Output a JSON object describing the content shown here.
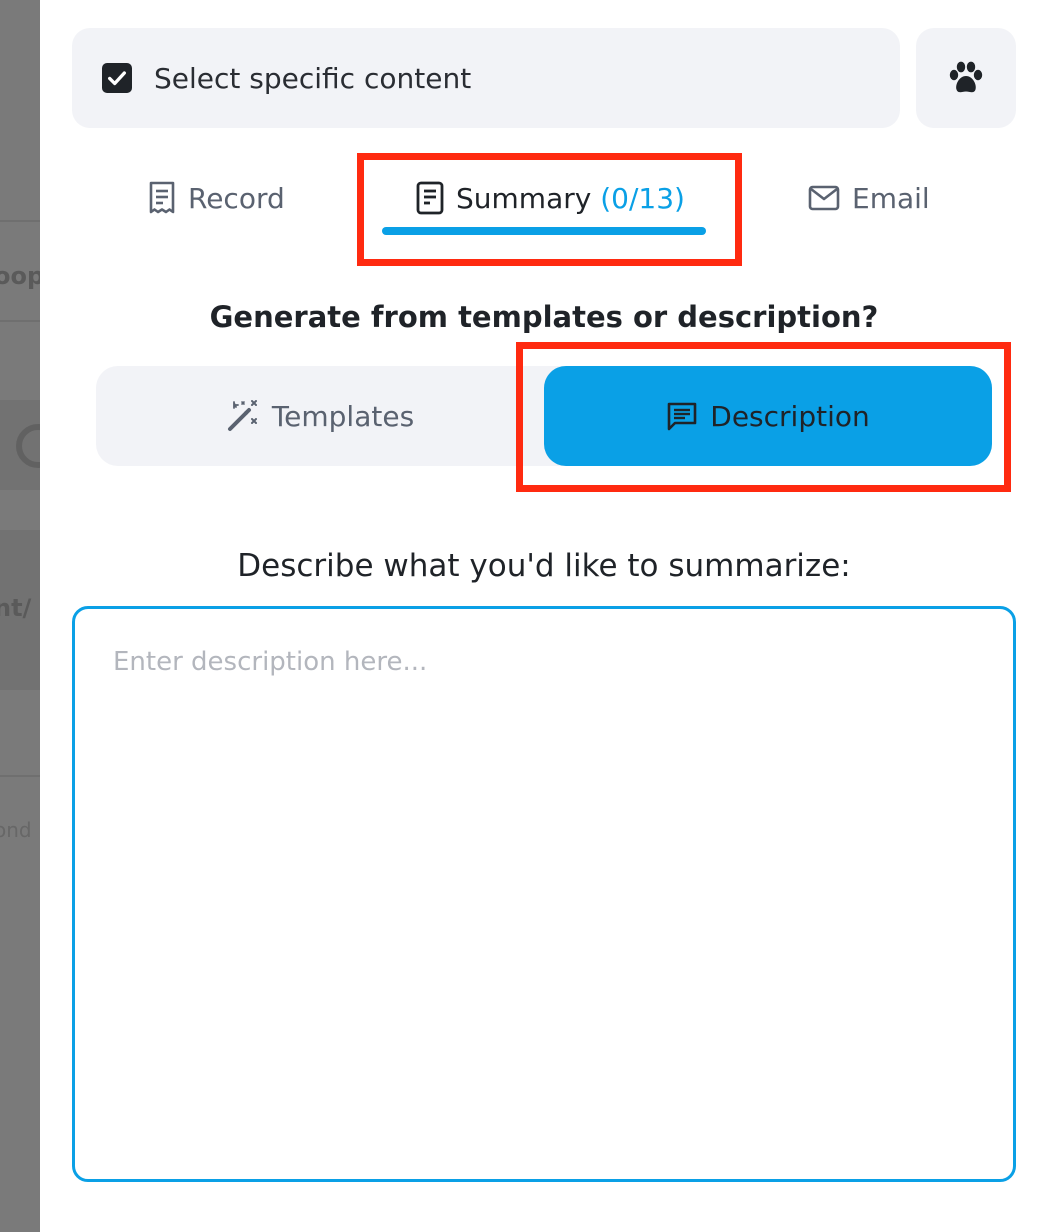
{
  "backdrop": {
    "ghost_texts": [
      "oop",
      "nt/",
      "ond"
    ]
  },
  "select_content": {
    "checked": true,
    "label": "Select specific content",
    "paw_icon": "paw-icon"
  },
  "tabs": [
    {
      "label": "Record",
      "icon": "receipt-icon",
      "active": false
    },
    {
      "label": "Summary",
      "count": "(0/13)",
      "icon": "document-icon",
      "active": true
    },
    {
      "label": "Email",
      "icon": "mail-icon",
      "active": false
    }
  ],
  "generate": {
    "question": "Generate from templates or description?",
    "templates_label": "Templates",
    "templates_icon": "magic-wand-icon",
    "description_label": "Description",
    "description_icon": "message-icon",
    "selected": "Description"
  },
  "description": {
    "prompt": "Describe what you'd like to summarize:",
    "placeholder": "Enter description here...",
    "value": ""
  },
  "colors": {
    "accent": "#0aa0e6",
    "highlight": "#ff2a10",
    "surface": "#f2f3f7",
    "text": "#1f2328",
    "muted": "#5a6270"
  }
}
